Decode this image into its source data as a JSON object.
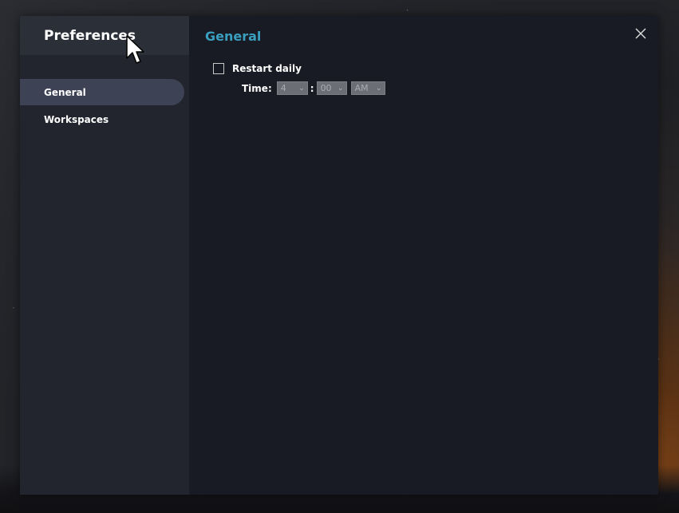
{
  "sidebar": {
    "title": "Preferences",
    "items": [
      {
        "label": "General",
        "active": true
      },
      {
        "label": "Workspaces",
        "active": false
      }
    ]
  },
  "main": {
    "title": "General",
    "restart": {
      "label": "Restart daily",
      "checked": false
    },
    "time": {
      "label": "Time:",
      "hour": "4",
      "separator": ":",
      "minute": "00",
      "ampm": "AM"
    }
  },
  "icons": {
    "close": "close-icon",
    "dropdown": "chevron-down-icon"
  },
  "colors": {
    "accent": "#3a9fbf",
    "sidebar_bg": "#22252e",
    "main_bg": "#181b23",
    "active_item": "#3d4254"
  }
}
